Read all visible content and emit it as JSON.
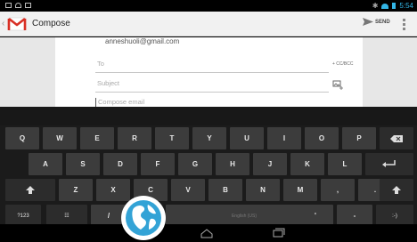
{
  "status_bar": {
    "time": "5:54"
  },
  "action_bar": {
    "title": "Compose",
    "send_label": "SEND"
  },
  "compose": {
    "from": "anneshuoli@gmail.com",
    "to_placeholder": "To",
    "cc_bcc_label": "+ CC/BCC",
    "subject_placeholder": "Subject",
    "body_placeholder": "Compose email"
  },
  "keyboard": {
    "row1": [
      "Q",
      "W",
      "E",
      "R",
      "T",
      "Y",
      "U",
      "I",
      "O",
      "P"
    ],
    "row2": [
      "A",
      "S",
      "D",
      "F",
      "G",
      "H",
      "J",
      "K",
      "L"
    ],
    "row3": [
      "Z",
      "X",
      "C",
      "V",
      "B",
      "N",
      "M",
      ",",
      "."
    ],
    "row3_hints": [
      "!",
      "?"
    ],
    "row4": {
      "symbols": "?123",
      "settings_glyph": "☷",
      "slash": "/",
      "space_label": "English (US)",
      "apostrophe": "'",
      "dash": "-",
      "emoticon": ":-)"
    },
    "icons": [
      "backspace-icon",
      "enter-icon",
      "shift-icon"
    ]
  },
  "colors": {
    "accent": "#33b5e5",
    "keyboard_bg": "#1b1b1b",
    "key": "#3c3c3c",
    "gmail_red": "#d93025",
    "globe": "#33a3d6"
  }
}
